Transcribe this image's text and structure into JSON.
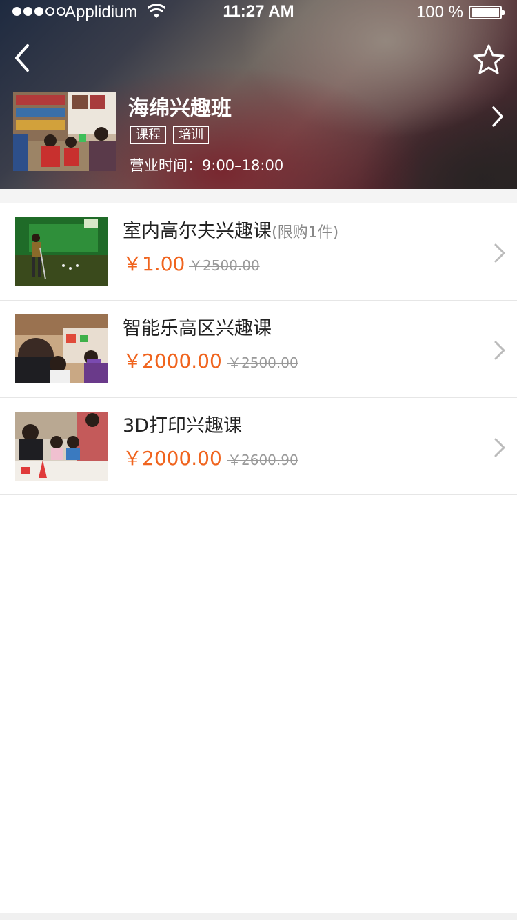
{
  "status_bar": {
    "carrier": "Applidium",
    "time": "11:27 AM",
    "battery": "100 %"
  },
  "header": {
    "shop_name": "海绵兴趣班",
    "tags": [
      "课程",
      "培训"
    ],
    "hours": "营业时间：9:00–18:00",
    "icons": {
      "back": "chevron-left-icon",
      "favorite": "star-icon",
      "detail": "chevron-right-icon"
    }
  },
  "products": [
    {
      "title": "室内高尔夫兴趣课",
      "limit": "(限购1件)",
      "price": "￥1.00",
      "original_price": "￥2500.00"
    },
    {
      "title": "智能乐高区兴趣课",
      "limit": "",
      "price": "￥2000.00",
      "original_price": "￥2500.00"
    },
    {
      "title": "3D打印兴趣课",
      "limit": "",
      "price": "￥2000.00",
      "original_price": "￥2600.90"
    }
  ],
  "colors": {
    "price": "#f0641e",
    "original_price": "#999999"
  }
}
